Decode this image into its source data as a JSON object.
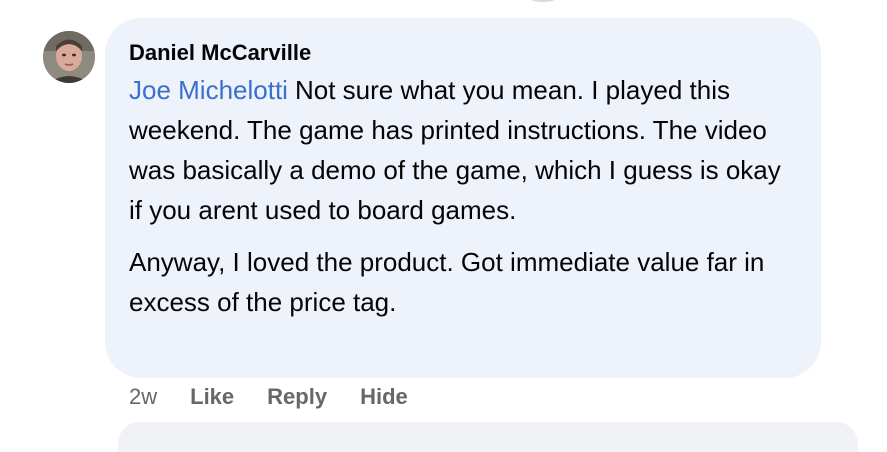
{
  "comment": {
    "author": "Daniel McCarville",
    "mention": "Joe Michelotti",
    "paragraph_1": "Not sure what you mean. I played this weekend. The game has printed instructions. The video was basically a demo of the game, which I guess is okay if you arent used to board games.",
    "paragraph_2": "Anyway, I loved the product. Got immediate value far in excess of the price tag."
  },
  "actions": {
    "timestamp": "2w",
    "like_label": "Like",
    "reply_label": "Reply",
    "hide_label": "Hide"
  },
  "colors": {
    "bubble_background": "#eef2fb",
    "mention_link": "#3b6fcc",
    "secondary_text": "#65676b",
    "primary_text": "#050505"
  }
}
